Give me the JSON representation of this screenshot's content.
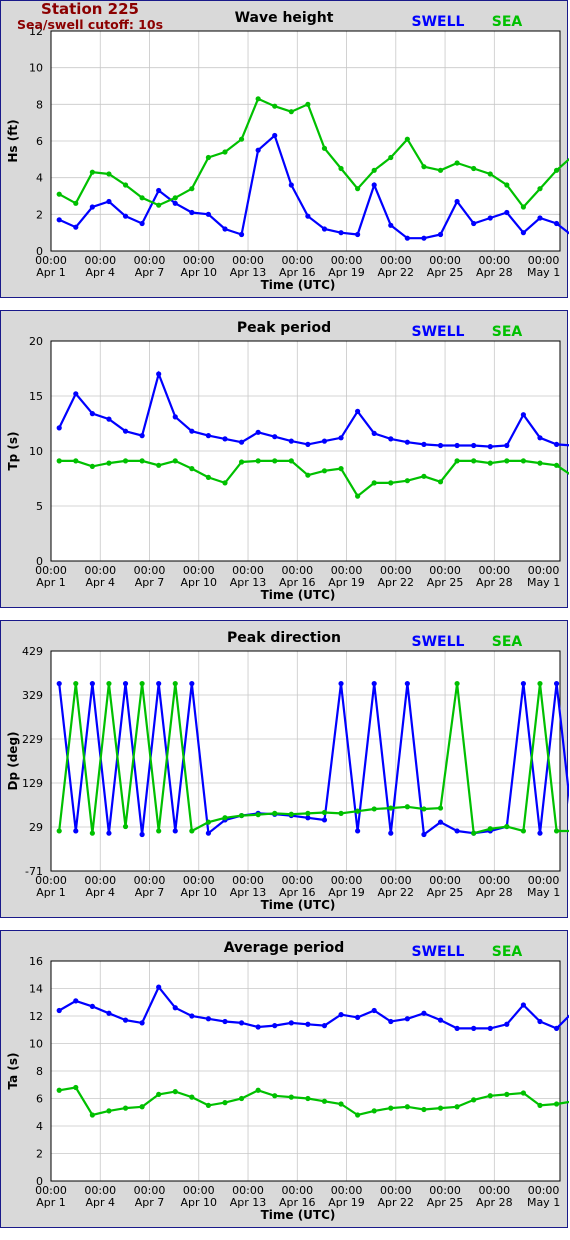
{
  "header": {
    "station_title": "Station 225",
    "cutoff_label": "Sea/swell cutoff: 10s"
  },
  "colors": {
    "swell": "#0000ff",
    "sea": "#00c000",
    "frame": "#1a1a8a",
    "panel_bg": "#d9d9d9"
  },
  "legend": {
    "swell": "SWELL",
    "sea": "SEA"
  },
  "x_axis": {
    "label": "Time (UTC)",
    "tick_time": "00:00",
    "ticks": [
      "Apr 1",
      "Apr 4",
      "Apr 7",
      "Apr 10",
      "Apr 13",
      "Apr 16",
      "Apr 19",
      "Apr 22",
      "Apr 25",
      "Apr 28",
      "May 1"
    ]
  },
  "chart_data": [
    {
      "type": "line",
      "title": "Wave height",
      "ylabel": "Hs (ft)",
      "ylim": [
        0,
        12
      ],
      "yticks": [
        0,
        2,
        4,
        6,
        8,
        10,
        12
      ],
      "x": [
        "Apr 1",
        "Apr 2",
        "Apr 3",
        "Apr 4",
        "Apr 5",
        "Apr 6",
        "Apr 7",
        "Apr 8",
        "Apr 9",
        "Apr 10",
        "Apr 11",
        "Apr 12",
        "Apr 13",
        "Apr 14",
        "Apr 15",
        "Apr 16",
        "Apr 17",
        "Apr 18",
        "Apr 19",
        "Apr 20",
        "Apr 21",
        "Apr 22",
        "Apr 23",
        "Apr 24",
        "Apr 25",
        "Apr 26",
        "Apr 27",
        "Apr 28",
        "Apr 29",
        "Apr 30",
        "May 1",
        "May 2"
      ],
      "series": [
        {
          "name": "SWELL",
          "values": [
            1.7,
            1.3,
            2.4,
            2.7,
            1.9,
            1.5,
            3.3,
            2.6,
            2.1,
            2.0,
            1.2,
            0.9,
            5.5,
            6.3,
            3.6,
            1.9,
            1.2,
            1.0,
            0.9,
            3.6,
            1.4,
            0.7,
            0.7,
            0.9,
            2.7,
            1.5,
            1.8,
            2.1,
            1.0,
            1.8,
            1.5,
            0.8
          ]
        },
        {
          "name": "SEA",
          "values": [
            3.1,
            2.6,
            4.3,
            4.2,
            3.6,
            2.9,
            2.5,
            2.9,
            3.4,
            5.1,
            5.4,
            6.1,
            8.3,
            7.9,
            7.6,
            8.0,
            5.6,
            4.5,
            3.4,
            4.4,
            5.1,
            6.1,
            4.6,
            4.4,
            4.8,
            4.5,
            4.2,
            3.6,
            2.4,
            3.4,
            4.4,
            5.2
          ]
        }
      ]
    },
    {
      "type": "scatter",
      "title": "Peak period",
      "ylabel": "Tp (s)",
      "ylim": [
        0,
        20
      ],
      "yticks": [
        0,
        5,
        10,
        15,
        20
      ],
      "x": [
        "Apr 1",
        "Apr 2",
        "Apr 3",
        "Apr 4",
        "Apr 5",
        "Apr 6",
        "Apr 7",
        "Apr 8",
        "Apr 9",
        "Apr 10",
        "Apr 11",
        "Apr 12",
        "Apr 13",
        "Apr 14",
        "Apr 15",
        "Apr 16",
        "Apr 17",
        "Apr 18",
        "Apr 19",
        "Apr 20",
        "Apr 21",
        "Apr 22",
        "Apr 23",
        "Apr 24",
        "Apr 25",
        "Apr 26",
        "Apr 27",
        "Apr 28",
        "Apr 29",
        "Apr 30",
        "May 1",
        "May 2"
      ],
      "series": [
        {
          "name": "SWELL",
          "values": [
            12.1,
            15.2,
            13.4,
            12.9,
            11.8,
            11.4,
            17.0,
            13.1,
            11.8,
            11.4,
            11.1,
            10.8,
            11.7,
            11.3,
            10.9,
            10.6,
            10.9,
            11.2,
            13.6,
            11.6,
            11.1,
            10.8,
            10.6,
            10.5,
            10.5,
            10.5,
            10.4,
            10.5,
            13.3,
            11.2,
            10.6,
            10.5
          ]
        },
        {
          "name": "SEA",
          "values": [
            9.1,
            9.1,
            8.6,
            8.9,
            9.1,
            9.1,
            8.7,
            9.1,
            8.4,
            7.6,
            7.1,
            9.0,
            9.1,
            9.1,
            9.1,
            7.8,
            8.2,
            8.4,
            5.9,
            7.1,
            7.1,
            7.3,
            7.7,
            7.2,
            9.1,
            9.1,
            8.9,
            9.1,
            9.1,
            8.9,
            8.7,
            7.7
          ]
        }
      ]
    },
    {
      "type": "scatter",
      "title": "Peak direction",
      "ylabel": "Dp (deg)",
      "ylim": [
        -71,
        429
      ],
      "yticks": [
        -71,
        29,
        129,
        229,
        329,
        429
      ],
      "x": [
        "Apr 1",
        "Apr 2",
        "Apr 3",
        "Apr 4",
        "Apr 5",
        "Apr 6",
        "Apr 7",
        "Apr 8",
        "Apr 9",
        "Apr 10",
        "Apr 11",
        "Apr 12",
        "Apr 13",
        "Apr 14",
        "Apr 15",
        "Apr 16",
        "Apr 17",
        "Apr 18",
        "Apr 19",
        "Apr 20",
        "Apr 21",
        "Apr 22",
        "Apr 23",
        "Apr 24",
        "Apr 25",
        "Apr 26",
        "Apr 27",
        "Apr 28",
        "Apr 29",
        "Apr 30",
        "May 1",
        "May 2"
      ],
      "series": [
        {
          "name": "SWELL",
          "values": [
            355,
            20,
            355,
            15,
            355,
            12,
            355,
            20,
            355,
            15,
            45,
            55,
            60,
            58,
            55,
            50,
            45,
            355,
            20,
            355,
            15,
            355,
            12,
            40,
            20,
            15,
            20,
            30,
            355,
            15,
            355,
            20
          ]
        },
        {
          "name": "SEA",
          "values": [
            20,
            355,
            15,
            355,
            30,
            355,
            20,
            355,
            20,
            40,
            50,
            55,
            57,
            60,
            58,
            60,
            62,
            60,
            65,
            70,
            72,
            75,
            70,
            72,
            355,
            15,
            25,
            30,
            20,
            355,
            20,
            20
          ]
        }
      ]
    },
    {
      "type": "line",
      "title": "Average period",
      "ylabel": "Ta (s)",
      "ylim": [
        0,
        16
      ],
      "yticks": [
        0,
        2,
        4,
        6,
        8,
        10,
        12,
        14,
        16
      ],
      "x": [
        "Apr 1",
        "Apr 2",
        "Apr 3",
        "Apr 4",
        "Apr 5",
        "Apr 6",
        "Apr 7",
        "Apr 8",
        "Apr 9",
        "Apr 10",
        "Apr 11",
        "Apr 12",
        "Apr 13",
        "Apr 14",
        "Apr 15",
        "Apr 16",
        "Apr 17",
        "Apr 18",
        "Apr 19",
        "Apr 20",
        "Apr 21",
        "Apr 22",
        "Apr 23",
        "Apr 24",
        "Apr 25",
        "Apr 26",
        "Apr 27",
        "Apr 28",
        "Apr 29",
        "Apr 30",
        "May 1",
        "May 2"
      ],
      "series": [
        {
          "name": "SWELL",
          "values": [
            12.4,
            13.1,
            12.7,
            12.2,
            11.7,
            11.5,
            14.1,
            12.6,
            12.0,
            11.8,
            11.6,
            11.5,
            11.2,
            11.3,
            11.5,
            11.4,
            11.3,
            12.1,
            11.9,
            12.4,
            11.6,
            11.8,
            12.2,
            11.7,
            11.1,
            11.1,
            11.1,
            11.4,
            12.8,
            11.6,
            11.1,
            12.3
          ]
        },
        {
          "name": "SEA",
          "values": [
            6.6,
            6.8,
            4.8,
            5.1,
            5.3,
            5.4,
            6.3,
            6.5,
            6.1,
            5.5,
            5.7,
            6.0,
            6.6,
            6.2,
            6.1,
            6.0,
            5.8,
            5.6,
            4.8,
            5.1,
            5.3,
            5.4,
            5.2,
            5.3,
            5.4,
            5.9,
            6.2,
            6.3,
            6.4,
            5.5,
            5.6,
            5.8
          ]
        }
      ]
    }
  ]
}
